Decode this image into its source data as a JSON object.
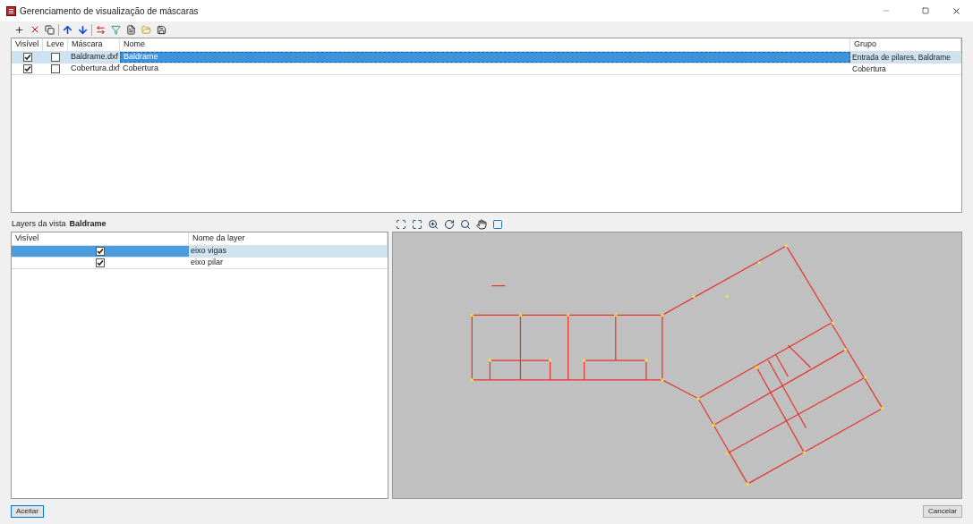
{
  "window": {
    "title": "Gerenciamento de visualização de máscaras"
  },
  "masks": {
    "columns": [
      "Visível",
      "Leve",
      "Máscara",
      "Nome",
      "Grupo"
    ],
    "rows": [
      {
        "visible": true,
        "light": false,
        "file": "Baldrame.dxf",
        "name": "Baldrame",
        "group": "Entrada de pilares, Baldrame",
        "selected": true
      },
      {
        "visible": true,
        "light": false,
        "file": "Cobertura.dxf",
        "name": "Cobertura",
        "group": "Cobertura",
        "selected": false
      }
    ]
  },
  "layers": {
    "label": "Layers da vista",
    "view_name": "Baldrame",
    "columns": [
      "Visível",
      "Nome da layer"
    ],
    "rows": [
      {
        "visible": true,
        "name": "eixo vigas",
        "selected": true
      },
      {
        "visible": true,
        "name": "eixo pilar",
        "selected": false
      }
    ]
  },
  "buttons": {
    "accept": "Aceitar",
    "cancel": "Cancelar"
  }
}
